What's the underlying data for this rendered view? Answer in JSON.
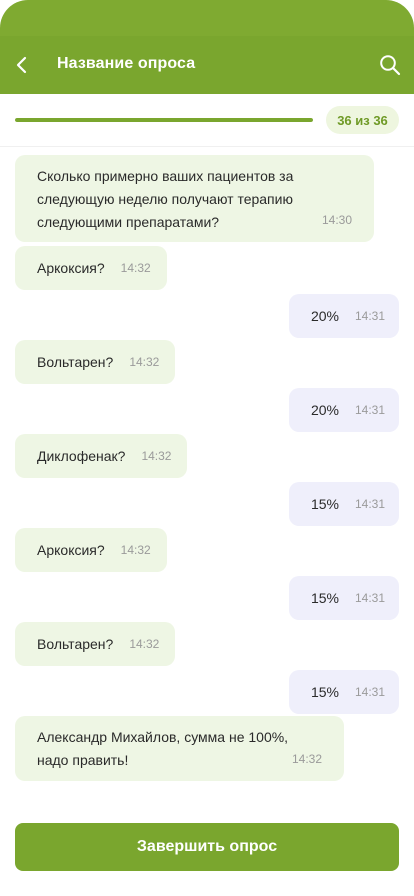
{
  "header": {
    "title": "Название опроса",
    "back_icon": "chevron-left-icon",
    "search_icon": "search-icon",
    "color": "#7aa62e"
  },
  "progress": {
    "label": "36 из 36",
    "fraction": 1.0
  },
  "messages": [
    {
      "side": "in",
      "text": "Сколько примерно ваших пациентов за следующую неделю получают терапию следующими препаратами?",
      "time": "14:30"
    },
    {
      "side": "in",
      "text": "Аркоксия?",
      "time": "14:32"
    },
    {
      "side": "out",
      "text": "20%",
      "time": "14:31"
    },
    {
      "side": "in",
      "text": "Вольтарен?",
      "time": "14:32"
    },
    {
      "side": "out",
      "text": "20%",
      "time": "14:31"
    },
    {
      "side": "in",
      "text": "Диклофенак?",
      "time": "14:32"
    },
    {
      "side": "out",
      "text": "15%",
      "time": "14:31"
    },
    {
      "side": "in",
      "text": "Аркоксия?",
      "time": "14:32"
    },
    {
      "side": "out",
      "text": "15%",
      "time": "14:31"
    },
    {
      "side": "in",
      "text": "Вольтарен?",
      "time": "14:32"
    },
    {
      "side": "out",
      "text": "15%",
      "time": "14:31"
    },
    {
      "side": "in",
      "text": "Александр Михайлов, сумма не 100%, надо править!",
      "time": "14:32"
    }
  ],
  "footer": {
    "finish_label": "Завершить опрос"
  }
}
